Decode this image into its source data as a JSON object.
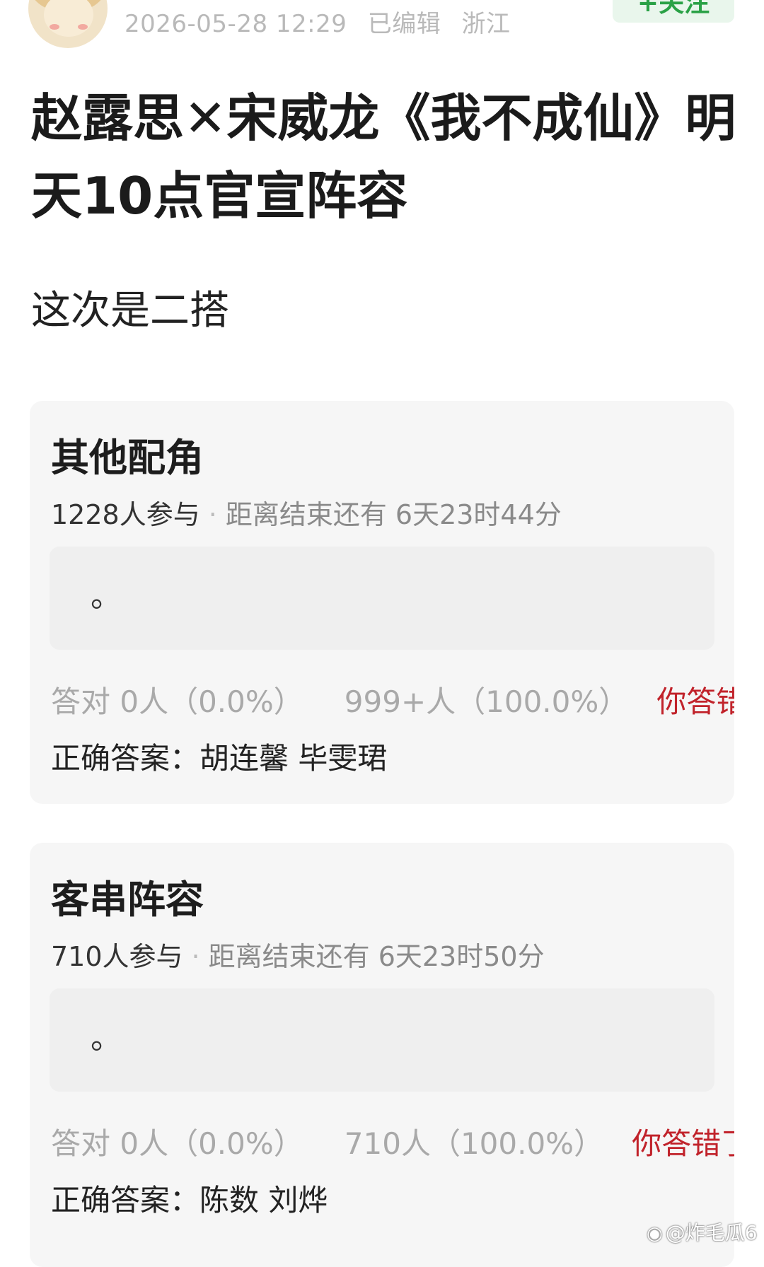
{
  "post": {
    "timestamp": "2026-05-28 12:29",
    "edited_label": "已编辑",
    "location": "浙江",
    "follow_label": "+关注",
    "title": "赵露思✕宋威龙《我不成仙》明天10点官宣阵容",
    "body": "这次是二搭"
  },
  "quizzes": [
    {
      "title": "其他配角",
      "participants": "1228人参与",
      "separator": "·",
      "countdown": "距离结束还有 6天23时44分",
      "option": "。",
      "correct_stat": "答对 0人（0.0%）",
      "wrong_stat": "999+人（100.0%）",
      "verdict": "你答错",
      "answer_label": "正确答案：",
      "answer_value": "胡连馨 毕雯珺"
    },
    {
      "title": "客串阵容",
      "participants": "710人参与",
      "separator": "·",
      "countdown": "距离结束还有 6天23时50分",
      "option": "。",
      "correct_stat": "答对 0人（0.0%）",
      "wrong_stat": "710人（100.0%）",
      "verdict": "你答错了",
      "answer_label": "正确答案：",
      "answer_value": "陈数 刘烨"
    }
  ],
  "watermark": {
    "text": "@炸毛瓜6",
    "icon": "weibo-icon"
  },
  "colors": {
    "follow_text": "#2aa146",
    "follow_bg": "#e9f6ec",
    "wrong_text": "#c1232b",
    "card_bg": "#f6f6f6"
  }
}
